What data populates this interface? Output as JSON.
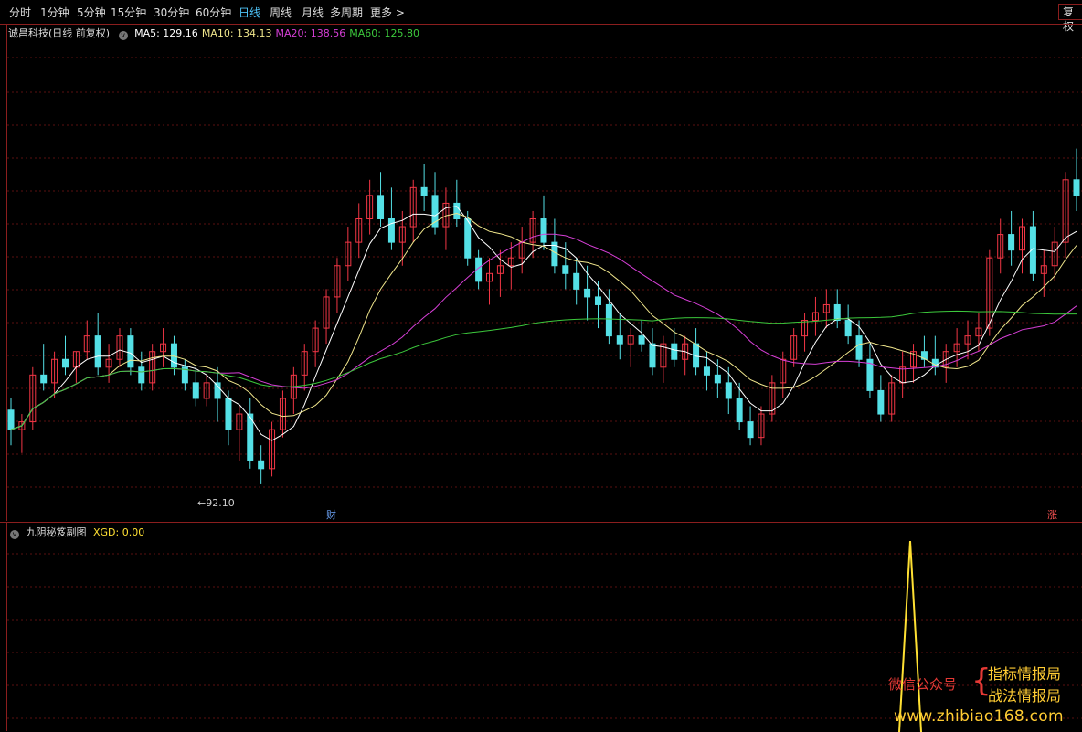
{
  "toolbar": {
    "periods": [
      "分时",
      "1分钟",
      "5分钟",
      "15分钟",
      "30分钟",
      "60分钟",
      "日线",
      "周线",
      "月线",
      "多周期",
      "更多 >"
    ],
    "active_period": "日线",
    "restore_label": "复权"
  },
  "main_panel": {
    "stock_title": "诚昌科技(日线 前复权)",
    "ma_legend": [
      {
        "label": "MA5: 129.16",
        "color": "#ffffff"
      },
      {
        "label": "MA10: 134.13",
        "color": "#f0e68c"
      },
      {
        "label": "MA20: 138.56",
        "color": "#d63fd6"
      },
      {
        "label": "MA60: 125.80",
        "color": "#3cc83c"
      }
    ],
    "low_annotation": "←92.10",
    "marker_finance": "财",
    "marker_limitup": "涨"
  },
  "sub_panel": {
    "title": "九阴秘笈副图",
    "xgd_label": "XGD: 0.00"
  },
  "watermark": {
    "account": "微信公众号",
    "line1": "指标情报局",
    "line2": "战法情报局",
    "url": "www.zhibiao168.com"
  },
  "colors": {
    "up": "#f23645",
    "down": "#54e0e6",
    "grid": "#5a1010",
    "border": "#8b1e1e",
    "signal": "#ffe033"
  },
  "chart_data": {
    "type": "candlestick",
    "price_low_marker": 92.1,
    "ohlc_approx": [
      [
        109,
        112,
        100,
        104
      ],
      [
        104,
        108,
        98,
        106
      ],
      [
        106,
        120,
        104,
        118
      ],
      [
        118,
        126,
        114,
        116
      ],
      [
        116,
        124,
        112,
        122
      ],
      [
        122,
        128,
        118,
        120
      ],
      [
        120,
        124,
        116,
        124
      ],
      [
        124,
        132,
        122,
        128
      ],
      [
        128,
        134,
        118,
        120
      ],
      [
        120,
        126,
        116,
        122
      ],
      [
        122,
        130,
        120,
        128
      ],
      [
        128,
        130,
        118,
        120
      ],
      [
        120,
        124,
        114,
        116
      ],
      [
        116,
        126,
        114,
        124
      ],
      [
        124,
        130,
        120,
        126
      ],
      [
        126,
        128,
        118,
        120
      ],
      [
        120,
        122,
        114,
        116
      ],
      [
        116,
        120,
        110,
        112
      ],
      [
        112,
        118,
        110,
        116
      ],
      [
        116,
        120,
        106,
        112
      ],
      [
        112,
        114,
        100,
        104
      ],
      [
        104,
        110,
        96,
        108
      ],
      [
        108,
        112,
        94,
        96
      ],
      [
        96,
        100,
        90,
        94
      ],
      [
        94,
        106,
        92,
        104
      ],
      [
        104,
        114,
        102,
        112
      ],
      [
        112,
        120,
        108,
        118
      ],
      [
        118,
        126,
        114,
        124
      ],
      [
        124,
        132,
        120,
        130
      ],
      [
        130,
        140,
        126,
        138
      ],
      [
        138,
        148,
        134,
        146
      ],
      [
        146,
        156,
        142,
        152
      ],
      [
        152,
        162,
        148,
        158
      ],
      [
        158,
        168,
        154,
        164
      ],
      [
        164,
        170,
        156,
        158
      ],
      [
        158,
        166,
        150,
        152
      ],
      [
        152,
        160,
        146,
        156
      ],
      [
        156,
        168,
        152,
        166
      ],
      [
        166,
        172,
        160,
        164
      ],
      [
        164,
        170,
        154,
        156
      ],
      [
        156,
        166,
        150,
        162
      ],
      [
        162,
        168,
        156,
        158
      ],
      [
        158,
        160,
        146,
        148
      ],
      [
        148,
        150,
        140,
        142
      ],
      [
        142,
        148,
        136,
        144
      ],
      [
        144,
        150,
        138,
        146
      ],
      [
        146,
        152,
        140,
        148
      ],
      [
        148,
        156,
        144,
        152
      ],
      [
        152,
        160,
        148,
        158
      ],
      [
        158,
        164,
        150,
        152
      ],
      [
        152,
        158,
        144,
        146
      ],
      [
        146,
        152,
        140,
        144
      ],
      [
        144,
        148,
        136,
        140
      ],
      [
        140,
        146,
        132,
        138
      ],
      [
        138,
        142,
        130,
        136
      ],
      [
        136,
        140,
        126,
        128
      ],
      [
        128,
        134,
        122,
        126
      ],
      [
        126,
        130,
        120,
        128
      ],
      [
        128,
        132,
        124,
        126
      ],
      [
        126,
        130,
        118,
        120
      ],
      [
        120,
        128,
        116,
        126
      ],
      [
        126,
        130,
        120,
        122
      ],
      [
        122,
        128,
        118,
        126
      ],
      [
        126,
        130,
        118,
        120
      ],
      [
        120,
        124,
        114,
        118
      ],
      [
        118,
        122,
        112,
        116
      ],
      [
        116,
        120,
        108,
        112
      ],
      [
        112,
        116,
        104,
        106
      ],
      [
        106,
        110,
        100,
        102
      ],
      [
        102,
        110,
        100,
        108
      ],
      [
        108,
        118,
        106,
        116
      ],
      [
        116,
        124,
        112,
        122
      ],
      [
        122,
        130,
        120,
        128
      ],
      [
        128,
        134,
        124,
        132
      ],
      [
        132,
        138,
        128,
        134
      ],
      [
        134,
        140,
        130,
        136
      ],
      [
        136,
        140,
        130,
        132
      ],
      [
        132,
        136,
        126,
        128
      ],
      [
        128,
        132,
        120,
        122
      ],
      [
        122,
        126,
        112,
        114
      ],
      [
        114,
        118,
        106,
        108
      ],
      [
        108,
        118,
        106,
        116
      ],
      [
        116,
        124,
        112,
        120
      ],
      [
        120,
        126,
        116,
        124
      ],
      [
        124,
        128,
        120,
        122
      ],
      [
        122,
        128,
        118,
        120
      ],
      [
        120,
        126,
        116,
        124
      ],
      [
        124,
        130,
        120,
        126
      ],
      [
        126,
        132,
        122,
        128
      ],
      [
        128,
        134,
        124,
        130
      ],
      [
        130,
        150,
        128,
        148
      ],
      [
        148,
        158,
        144,
        154
      ],
      [
        154,
        160,
        146,
        150
      ],
      [
        150,
        158,
        144,
        156
      ],
      [
        156,
        160,
        142,
        144
      ],
      [
        144,
        150,
        138,
        146
      ],
      [
        146,
        156,
        142,
        152
      ],
      [
        152,
        170,
        148,
        168
      ],
      [
        168,
        176,
        160,
        164
      ]
    ],
    "ma_series": [
      "MA5",
      "MA10",
      "MA20",
      "MA60"
    ],
    "xgd_signal": [
      {
        "position": "near-right",
        "value": 1
      }
    ]
  }
}
